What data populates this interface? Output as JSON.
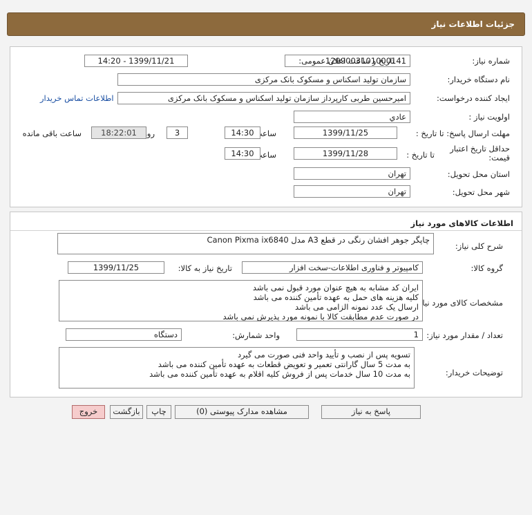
{
  "header": {
    "title": "جزئیات اطلاعات نیاز"
  },
  "info": {
    "need_number_label": "شماره نیاز:",
    "need_number": "1299003101000141",
    "announce_label": "تاریخ و ساعت اعلان عمومی:",
    "announce_value": "1399/11/21 - 14:20",
    "buyer_org_label": "نام دستگاه خریدار:",
    "buyer_org": "سازمان تولید اسکناس و مسکوک بانک مرکزی",
    "requester_label": "ایجاد کننده درخواست:",
    "requester": "امیرحسین طربی کارپرداز سازمان تولید اسکناس و مسکوک بانک مرکزی",
    "contact_link": "اطلاعات تماس خریدار",
    "priority_label": "اولویت نیاز :",
    "priority": "عادي",
    "deadline_label": "مهلت ارسال پاسخ: تا تاریخ :",
    "deadline_date": "1399/11/25",
    "time_label": "ساعت",
    "deadline_time": "14:30",
    "days_count": "3",
    "days_label": "روز و",
    "remaining_time": "18:22:01",
    "remaining_label": "ساعت باقی مانده",
    "validity_label": "حداقل تاریخ اعتبار قیمت:",
    "validity_to_label": "تا تاریخ :",
    "validity_date": "1399/11/28",
    "validity_time": "14:30",
    "province_label": "استان محل تحویل:",
    "province": "تهران",
    "city_label": "شهر محل تحویل:",
    "city": "تهران"
  },
  "goods": {
    "title": "اطلاعات کالاهای مورد نیاز",
    "general_desc_label": "شرح کلی نیاز:",
    "general_desc": "چاپگر جوهر افشان رنگی در قطع A3  مدل Canon Pixma ix6840",
    "group_label": "گروه کالا:",
    "group": "کامپیوتر و فناوری اطلاعات-سخت افزار",
    "need_date_label": "تاریخ نیاز به کالا:",
    "need_date": "1399/11/25",
    "specs_label": "مشخصات کالای مورد نیاز:",
    "specs": [
      "ایران کد مشابه به هیچ عنوان مورد قبول نمی باشد",
      "کلیه هزینه های حمل به عهده تأمین کننده می باشد",
      "ارسال یک عدد نمونه الزامی می باشد",
      "در صورت عدم مطابقت کالا با نمونه مورد پذیرش نمی باشد"
    ],
    "qty_label": "تعداد / مقدار مورد نیاز:",
    "qty": "1",
    "unit_label": "واحد شمارش:",
    "unit": "دستگاه",
    "notes_label": "توضیحات خریدار:",
    "notes": [
      "تسویه پس از نصب و تأیید واحد فنی صورت می گیرد",
      "به مدت 5 سال گارانتی تعمیر و تعویض قطعات به عهده تأمین کننده می باشد",
      "به مدت 10 سال خدمات پس از فروش کلیه اقلام به عهده تأمین کننده می باشد"
    ]
  },
  "buttons": {
    "reply": "پاسخ به نیاز",
    "attachments": "مشاهده مدارک پیوستی (0)",
    "print": "چاپ",
    "back": "بازگشت",
    "exit": "خروج"
  }
}
